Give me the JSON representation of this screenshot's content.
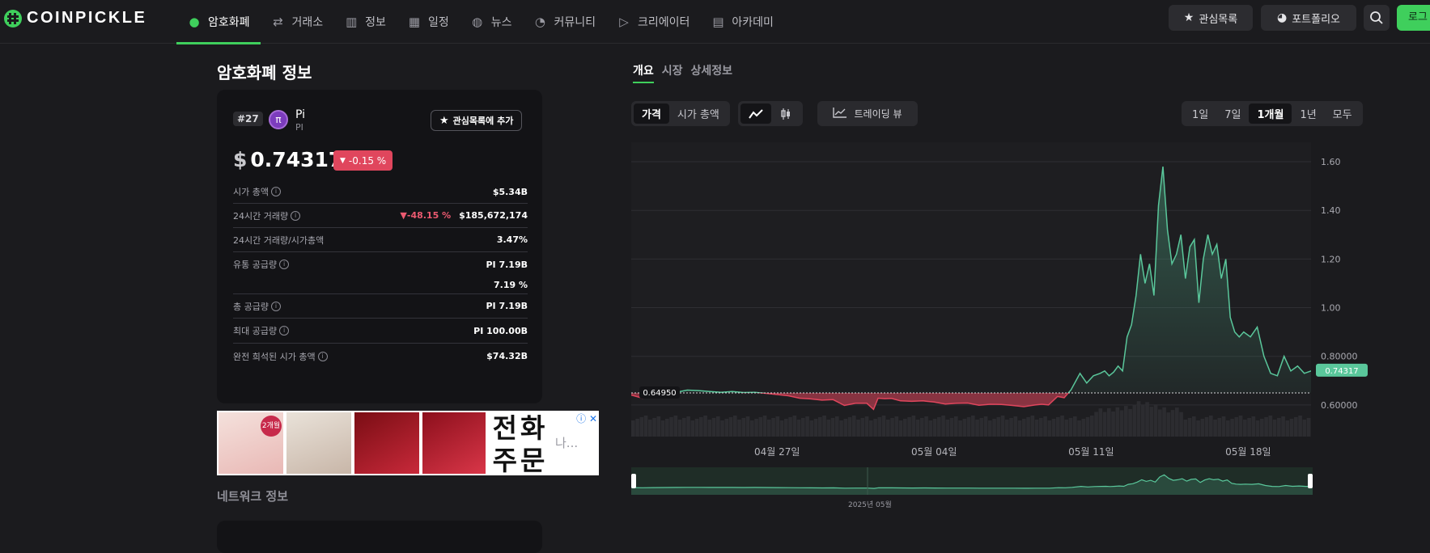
{
  "nav": {
    "logo_text": "COINPICKLE",
    "menu": [
      {
        "label": "암호화폐",
        "icon": "coins-icon",
        "glyph": "●",
        "active": true
      },
      {
        "label": "거래소",
        "icon": "exchange-icon",
        "glyph": "⇄",
        "active": false
      },
      {
        "label": "정보",
        "icon": "bar-chart-icon",
        "glyph": "▥",
        "active": false
      },
      {
        "label": "일정",
        "icon": "calendar-icon",
        "glyph": "▦",
        "active": false
      },
      {
        "label": "뉴스",
        "icon": "globe-icon",
        "glyph": "◍",
        "active": false
      },
      {
        "label": "커뮤니티",
        "icon": "chat-icon",
        "glyph": "◔",
        "active": false
      },
      {
        "label": "크리에이터",
        "icon": "play-icon",
        "glyph": "▷",
        "active": false
      },
      {
        "label": "아카데미",
        "icon": "book-icon",
        "glyph": "▤",
        "active": false
      }
    ],
    "watchlist_label": "관심목록",
    "portfolio_label": "포트폴리오",
    "login_label": "로그"
  },
  "page_title": "암호화폐 정보",
  "coin": {
    "rank": "#27",
    "name": "Pi",
    "symbol": "PI",
    "watch_add_label": "관심목록에 추가",
    "currency_symbol": "$",
    "price": "0.74317",
    "change": "-0.15 %",
    "stats": [
      {
        "label": "시가 총액",
        "info": true,
        "value": "$5.34B",
        "change": ""
      },
      {
        "label": "24시간 거래량",
        "info": true,
        "value": "$185,672,174",
        "change": "-48.15 %"
      },
      {
        "label": "24시간 거래량/시가총액",
        "info": false,
        "value": "3.47%",
        "change": ""
      },
      {
        "label": "유통 공급량",
        "info": true,
        "value": "PI 7.19B",
        "change": ""
      },
      {
        "label": "",
        "info": false,
        "value": "7.19 %",
        "change": ""
      },
      {
        "label": "총 공급량",
        "info": true,
        "value": "PI 7.19B",
        "change": ""
      },
      {
        "label": "최대 공급량",
        "info": true,
        "value": "PI 100.00B",
        "change": ""
      },
      {
        "label": "완전 희석된 시가 총액",
        "info": true,
        "value": "$74.32B",
        "change": ""
      }
    ]
  },
  "ad": {
    "badge": "2개월",
    "big_text_top": "전화",
    "big_text_bottom": "주문",
    "more": "나..."
  },
  "network_title": "네트워크 정보",
  "tabs": [
    {
      "label": "개요",
      "active": true
    },
    {
      "label": "시장",
      "active": false
    },
    {
      "label": "상세정보",
      "active": false
    }
  ],
  "controls": {
    "metric_options": [
      {
        "label": "가격",
        "on": true
      },
      {
        "label": "시가 총액",
        "on": false
      }
    ],
    "chart_type_icons": [
      "line-chart-icon",
      "candlestick-icon"
    ],
    "trading_view_label": "트레이딩 뷰",
    "periods": [
      {
        "label": "1일",
        "on": false
      },
      {
        "label": "7일",
        "on": false
      },
      {
        "label": "1개월",
        "on": true
      },
      {
        "label": "1년",
        "on": false
      },
      {
        "label": "모두",
        "on": false
      }
    ]
  },
  "chart_data": {
    "type": "area",
    "title": "",
    "y_ticks": [
      "1.60",
      "1.40",
      "1.20",
      "1.00",
      "0.80000",
      "0.60000"
    ],
    "ylim": [
      0.47,
      1.66
    ],
    "x_ticks": [
      "04월 27일",
      "05월 04일",
      "05월 11일",
      "05월 18일"
    ],
    "x_tick_days": [
      6.5,
      13.5,
      20.5,
      27.5
    ],
    "x_days_range": [
      0,
      30.3
    ],
    "reference_label": "0.64950",
    "reference_value": 0.6495,
    "current_label": "0.74317",
    "current_value": 0.74317,
    "range_label": "2025년 05월",
    "up_color": "#5ac79b",
    "down_color": "#e0465d",
    "series": [
      {
        "x": [
          0,
          0.5,
          1,
          1.5,
          2,
          2.5,
          3,
          3.5,
          4,
          4.5,
          5,
          5.5,
          6,
          6.5,
          7,
          7.5,
          8,
          8.5,
          9,
          9.5,
          10,
          10.5,
          10.8,
          11,
          11.3,
          11.6,
          12,
          12.5,
          13,
          13.5,
          14,
          14.5,
          15,
          15.5,
          16,
          16.5,
          17,
          17.5,
          18,
          18.3,
          18.6,
          19,
          19.3,
          19.6,
          20,
          20.3,
          20.6,
          20.9,
          21.1,
          21.3,
          21.5,
          21.7,
          21.9,
          22.1,
          22.3,
          22.5,
          22.7,
          22.9,
          23.1,
          23.3,
          23.5,
          23.7,
          23.9,
          24.1,
          24.3,
          24.5,
          24.7,
          24.9,
          25.1,
          25.3,
          25.5,
          25.7,
          25.9,
          26.1,
          26.3,
          26.5,
          26.7,
          26.9,
          27.1,
          27.3,
          27.6,
          27.9,
          28.2,
          28.5,
          28.8,
          29.1,
          29.4,
          29.7,
          30,
          30.3
        ],
        "y": [
          0.641,
          0.628,
          0.641,
          0.65,
          0.652,
          0.661,
          0.659,
          0.655,
          0.652,
          0.655,
          0.651,
          0.652,
          0.648,
          0.643,
          0.638,
          0.628,
          0.625,
          0.62,
          0.622,
          0.598,
          0.607,
          0.607,
          0.582,
          0.628,
          0.626,
          0.627,
          0.617,
          0.615,
          0.617,
          0.612,
          0.604,
          0.607,
          0.608,
          0.599,
          0.603,
          0.602,
          0.598,
          0.593,
          0.6,
          0.603,
          0.6,
          0.635,
          0.63,
          0.662,
          0.73,
          0.69,
          0.72,
          0.73,
          0.74,
          0.72,
          0.735,
          0.76,
          0.74,
          0.88,
          0.93,
          1.05,
          1.22,
          1.1,
          1.18,
          1.05,
          1.42,
          1.58,
          1.32,
          1.18,
          1.22,
          1.3,
          1.12,
          1.25,
          1.28,
          1.02,
          1.2,
          1.3,
          1.22,
          1.26,
          1.12,
          1.2,
          0.96,
          0.9,
          0.88,
          0.9,
          0.88,
          0.92,
          0.8,
          0.73,
          0.72,
          0.8,
          0.74,
          0.76,
          0.73,
          0.74
        ]
      }
    ]
  }
}
